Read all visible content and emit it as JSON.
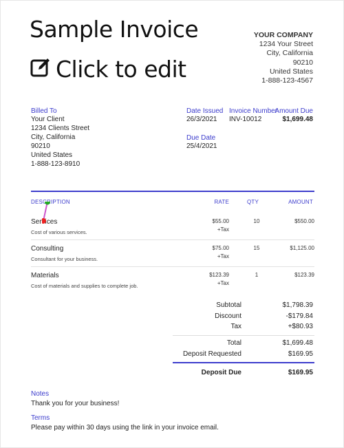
{
  "header": {
    "title": "Sample Invoice",
    "edit_label": "Click to edit"
  },
  "company": {
    "name": "YOUR COMPANY",
    "street": "1234 Your Street",
    "city": "City, California",
    "zip": "90210",
    "country": "United States",
    "phone": "1-888-123-4567"
  },
  "billed_to": {
    "label": "Billed To",
    "name": "Your Client",
    "street": "1234 Clients Street",
    "city": "City, California",
    "zip": "90210",
    "country": "United States",
    "phone": "1-888-123-8910"
  },
  "meta": {
    "date_issued_label": "Date Issued",
    "date_issued": "26/3/2021",
    "invoice_number_label": "Invoice Number",
    "invoice_number": "INV-10012",
    "amount_due_label": "Amount Due",
    "amount_due": "$1,699.48",
    "due_date_label": "Due Date",
    "due_date": "25/4/2021"
  },
  "table": {
    "headers": {
      "description": "DESCRIPTION",
      "rate": "RATE",
      "qty": "QTY",
      "amount": "AMOUNT"
    },
    "rows": [
      {
        "name": "Services",
        "desc": "Cost of various services.",
        "rate": "$55.00",
        "tax": "+Tax",
        "qty": "10",
        "amount": "$550.00"
      },
      {
        "name": "Consulting",
        "desc": "Consultant for your business.",
        "rate": "$75.00",
        "tax": "+Tax",
        "qty": "15",
        "amount": "$1,125.00"
      },
      {
        "name": "Materials",
        "desc": "Cost of materials and supplies to complete job.",
        "rate": "$123.39",
        "tax": "+Tax",
        "qty": "1",
        "amount": "$123.39"
      }
    ]
  },
  "totals": {
    "subtotal_label": "Subtotal",
    "subtotal": "$1,798.39",
    "discount_label": "Discount",
    "discount": "-$179.84",
    "tax_label": "Tax",
    "tax": "+$80.93",
    "total_label": "Total",
    "total": "$1,699.48",
    "deposit_requested_label": "Deposit Requested",
    "deposit_requested": "$169.95",
    "deposit_due_label": "Deposit Due",
    "deposit_due": "$169.95"
  },
  "notes": {
    "label": "Notes",
    "text": "Thank you for your business!"
  },
  "terms": {
    "label": "Terms",
    "text": "Please pay within 30 days using the link in your invoice email."
  },
  "colors": {
    "accent": "#3b3bcc",
    "cursor_start": "#22aa22",
    "cursor_end": "#ee2222",
    "drag_path": "#cc55cc"
  }
}
